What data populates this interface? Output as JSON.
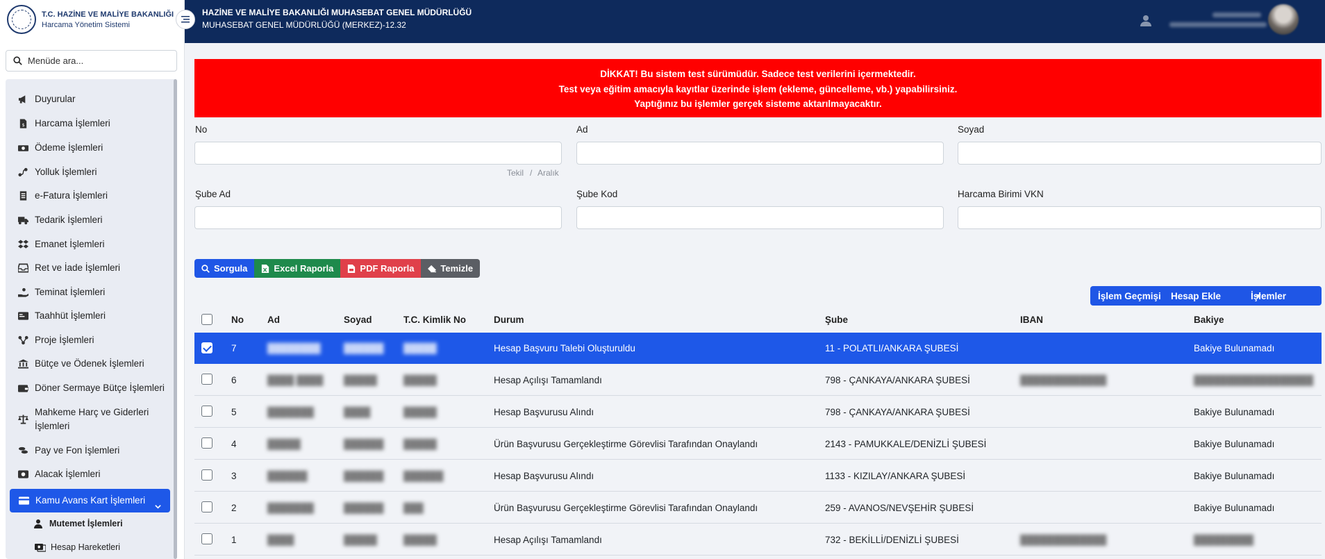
{
  "brand": {
    "title": "T.C. HAZİNE VE MALİYE BAKANLIĞI",
    "subtitle": "Harcama Yönetim Sistemi"
  },
  "menu_search": {
    "placeholder": "Menüde ara..."
  },
  "menu": {
    "items": [
      {
        "label": "Duyurular",
        "icon": "megaphone-icon"
      },
      {
        "label": "Harcama İşlemleri",
        "icon": "file-money-icon"
      },
      {
        "label": "Ödeme İşlemleri",
        "icon": "cash-icon"
      },
      {
        "label": "Yolluk İşlemleri",
        "icon": "route-icon"
      },
      {
        "label": "e-Fatura İşlemleri",
        "icon": "invoice-icon"
      },
      {
        "label": "Tedarik İşlemleri",
        "icon": "truck-icon"
      },
      {
        "label": "Emanet İşlemleri",
        "icon": "boxes-icon"
      },
      {
        "label": "Ret ve İade İşlemleri",
        "icon": "inbox-icon"
      },
      {
        "label": "Teminat İşlemleri",
        "icon": "hand-coin-icon"
      },
      {
        "label": "Taahhüt İşlemleri",
        "icon": "card-icon"
      },
      {
        "label": "Proje İşlemleri",
        "icon": "diagram-icon"
      },
      {
        "label": "Bütçe ve Ödenek İşlemleri",
        "icon": "bank-icon"
      },
      {
        "label": "Döner Sermaye Bütçe İşlemleri",
        "icon": "wallet-icon"
      },
      {
        "label": "Mahkeme Harç ve Giderleri İşlemleri",
        "icon": "scale-icon"
      },
      {
        "label": "Pay ve Fon İşlemleri",
        "icon": "coins-icon"
      },
      {
        "label": "Alacak İşlemleri",
        "icon": "money-bill-icon"
      },
      {
        "label": "Kamu Avans Kart İşlemleri",
        "icon": "credit-card-icon"
      }
    ],
    "sub_items": [
      {
        "label": "Mutemet İşlemleri",
        "icon": "user-icon"
      },
      {
        "label": "Hesap Hareketleri",
        "icon": "transactions-icon"
      }
    ]
  },
  "header": {
    "title": "HAZİNE VE MALİYE BAKANLIĞI MUHASEBAT GENEL MÜDÜRLÜĞÜ",
    "subtitle": "MUHASEBAT GENEL MÜDÜRLÜĞÜ (MERKEZ)-12.32"
  },
  "alert": {
    "line1": "DİKKAT! Bu sistem test sürümüdür. Sadece test verilerini içermektedir.",
    "line2": "Test veya eğitim amacıyla kayıtlar üzerinde işlem (ekleme, güncelleme, vb.) yapabilirsiniz.",
    "line3": "Yaptığınız bu işlemler gerçek sisteme aktarılmayacaktır."
  },
  "filters": {
    "no_label": "No",
    "ad_label": "Ad",
    "soyad_label": "Soyad",
    "no_hint_tekil": "Tekil",
    "no_hint_sep": "/",
    "no_hint_aralik": "Aralık",
    "sube_ad_label": "Şube Ad",
    "sube_kod_label": "Şube Kod",
    "vkn_label": "Harcama Birimi VKN"
  },
  "buttons": {
    "sorgula": "Sorgula",
    "excel": "Excel Raporla",
    "pdf": "PDF Raporla",
    "temizle": "Temizle",
    "islem_gecmisi": "İşlem Geçmişi",
    "hesap_ekle": "Hesap Ekle",
    "islemler": "İşlemler"
  },
  "table": {
    "columns": [
      "No",
      "Ad",
      "Soyad",
      "T.C. Kimlik No",
      "Durum",
      "Şube",
      "IBAN",
      "Bakiye"
    ],
    "rows": [
      {
        "no": "7",
        "durum": "Hesap Başvuru Talebi Oluşturuldu",
        "sube": "11 - POLATLI/ANKARA ŞUBESİ",
        "bakiye": "Bakiye Bulunamadı",
        "selected": true
      },
      {
        "no": "6",
        "durum": "Hesap Açılışı Tamamlandı",
        "sube": "798 - ÇANKAYA/ANKARA ŞUBESİ",
        "bakiye": ""
      },
      {
        "no": "5",
        "durum": "Hesap Başvurusu Alındı",
        "sube": "798 - ÇANKAYA/ANKARA ŞUBESİ",
        "bakiye": "Bakiye Bulunamadı"
      },
      {
        "no": "4",
        "durum": "Ürün Başvurusu Gerçekleştirme Görevlisi Tarafından Onaylandı",
        "sube": "2143 - PAMUKKALE/DENİZLİ ŞUBESİ",
        "bakiye": "Bakiye Bulunamadı"
      },
      {
        "no": "3",
        "durum": "Hesap Başvurusu Alındı",
        "sube": "1133 - KIZILAY/ANKARA ŞUBESİ",
        "bakiye": "Bakiye Bulunamadı"
      },
      {
        "no": "2",
        "durum": "Ürün Başvurusu Gerçekleştirme Görevlisi Tarafından Onaylandı",
        "sube": "259 - AVANOS/NEVŞEHİR ŞUBESİ",
        "bakiye": "Bakiye Bulunamadı"
      },
      {
        "no": "1",
        "durum": "Hesap Açılışı Tamamlandı",
        "sube": "732 - BEKİLLİ/DENİZLİ ŞUBESİ",
        "bakiye": ""
      }
    ]
  },
  "colors": {
    "primary": "#1e58e8",
    "header_bg": "#0e2a5c",
    "alert_bg": "#ff0000",
    "excel": "#1e8a4c",
    "pdf": "#e0404a",
    "temizle": "#5b5e64"
  }
}
